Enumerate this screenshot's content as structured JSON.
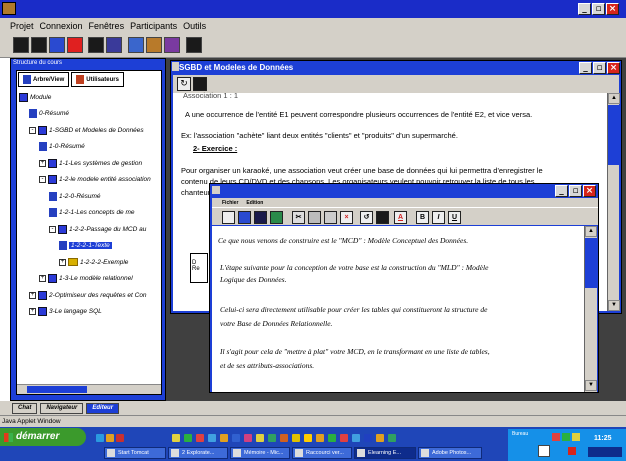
{
  "menubar": {
    "items": [
      "Projet",
      "Connexion",
      "Fenêtres",
      "Participants",
      "Outils"
    ]
  },
  "main_toolbar": {
    "icons": [
      "square-dark-icon",
      "square-dark-icon",
      "save-icon",
      "close-red-icon",
      "square-dark-icon",
      "people-icon",
      "tree-icon",
      "tools-icon",
      "book-icon",
      "square-dark-icon"
    ]
  },
  "left_panel": {
    "title": "Structure du cours",
    "tabs": [
      "Arbre/View",
      "Utilisateurs"
    ],
    "tree": [
      {
        "label": "Module",
        "depth": 0,
        "kind": "book"
      },
      {
        "label": "0-Résumé",
        "depth": 1,
        "kind": "page"
      },
      {
        "label": "1-SGBD et Modeles de Données",
        "depth": 1,
        "kind": "book",
        "exp": "-"
      },
      {
        "label": "1-0-Résumé",
        "depth": 2,
        "kind": "page"
      },
      {
        "label": "1-1-Les systèmes de gestion",
        "depth": 2,
        "kind": "book",
        "exp": "+"
      },
      {
        "label": "1-2-le modele entité association",
        "depth": 2,
        "kind": "book",
        "exp": "-"
      },
      {
        "label": "1-2-0-Résumé",
        "depth": 3,
        "kind": "page"
      },
      {
        "label": "1-2-1-Les concepts de me",
        "depth": 3,
        "kind": "page"
      },
      {
        "label": "1-2-2-Passage du MCD au",
        "depth": 3,
        "kind": "book",
        "exp": "-"
      },
      {
        "label": "1-2-2-1-Texte",
        "depth": 4,
        "kind": "page",
        "selected": true
      },
      {
        "label": "1-2-2-2-Exemple",
        "depth": 4,
        "kind": "folder",
        "exp": "+"
      },
      {
        "label": "1-3-Le modèle relationnel",
        "depth": 2,
        "kind": "book",
        "exp": "+"
      },
      {
        "label": "2-Optimiseur des requêtes et Con",
        "depth": 1,
        "kind": "book",
        "exp": "+"
      },
      {
        "label": "3-Le langage SQL",
        "depth": 1,
        "kind": "book",
        "exp": "+"
      }
    ]
  },
  "sgbd_window": {
    "title": "SGBD et Modeles de Données",
    "lines": [
      "Association 1 : 1",
      "A une occurrence de l'entité E1 peuvent correspondre plusieurs occurrences de l'entité E2, et vice versa.",
      "Ex: l'association \"achète\" liant deux entités \"clients\" et \"produits\" d'un supermarché.",
      "2- Exercice :",
      "Pour organiser un karaoké, une association veut créer une base de données qui lui permettra d'enregistrer le",
      "contenu de leurs CD/DVD et des chansons. Les organisateurs veulent pouvoir retrouver la liste de tous les",
      "chanteurs"
    ],
    "side_fragments": [
      "D",
      "Re"
    ]
  },
  "editor_window": {
    "menu": [
      "Fichier",
      "Edition"
    ],
    "toolbar_labels": [
      "",
      "",
      "",
      "",
      "",
      "",
      "",
      "",
      "",
      "",
      "",
      "A",
      "B",
      "I",
      "U"
    ],
    "paragraphs": [
      [
        "Ce que nous venons de construire est le \"MCD\" : Modèle Conceptuel des Données."
      ],
      [
        "L'étape suivante pour la conception de votre base est la construction du \"MLD\" : Modèle",
        "Logique des Données."
      ],
      [
        "Celui-ci sera directement utilisable pour créer les tables qui constitueront la structure de",
        "votre Base de Données Relationnelle."
      ],
      [
        "Il s'agit pour cela de \"mettre à plat\" votre MCD, en le transformant en une liste de tables,",
        "et de ses attributs-associations."
      ]
    ]
  },
  "bottom_tabs": [
    {
      "label": "Chat",
      "active": false
    },
    {
      "label": "Navigateur",
      "active": false
    },
    {
      "label": "Editeur",
      "active": true
    }
  ],
  "status": "Java Applet Window",
  "taskbar": {
    "start": "démarrer",
    "tasks": [
      {
        "label": "Start Tomcat",
        "active": false
      },
      {
        "label": "2 Explorate...",
        "active": false
      },
      {
        "label": "Mémoire - Mic...",
        "active": false
      },
      {
        "label": "Raccourci ver...",
        "active": false
      },
      {
        "label": "Elearning E...",
        "active": true
      },
      {
        "label": "Adobe Photos...",
        "active": false
      }
    ],
    "tray_time": "11:25",
    "tray_label": "Bureau"
  },
  "colors": {
    "title_blue": "#1d3fd6",
    "taskbar_blue": "#1f46b8",
    "start_green": "#3b9a2c",
    "close_red": "#d6251b"
  }
}
